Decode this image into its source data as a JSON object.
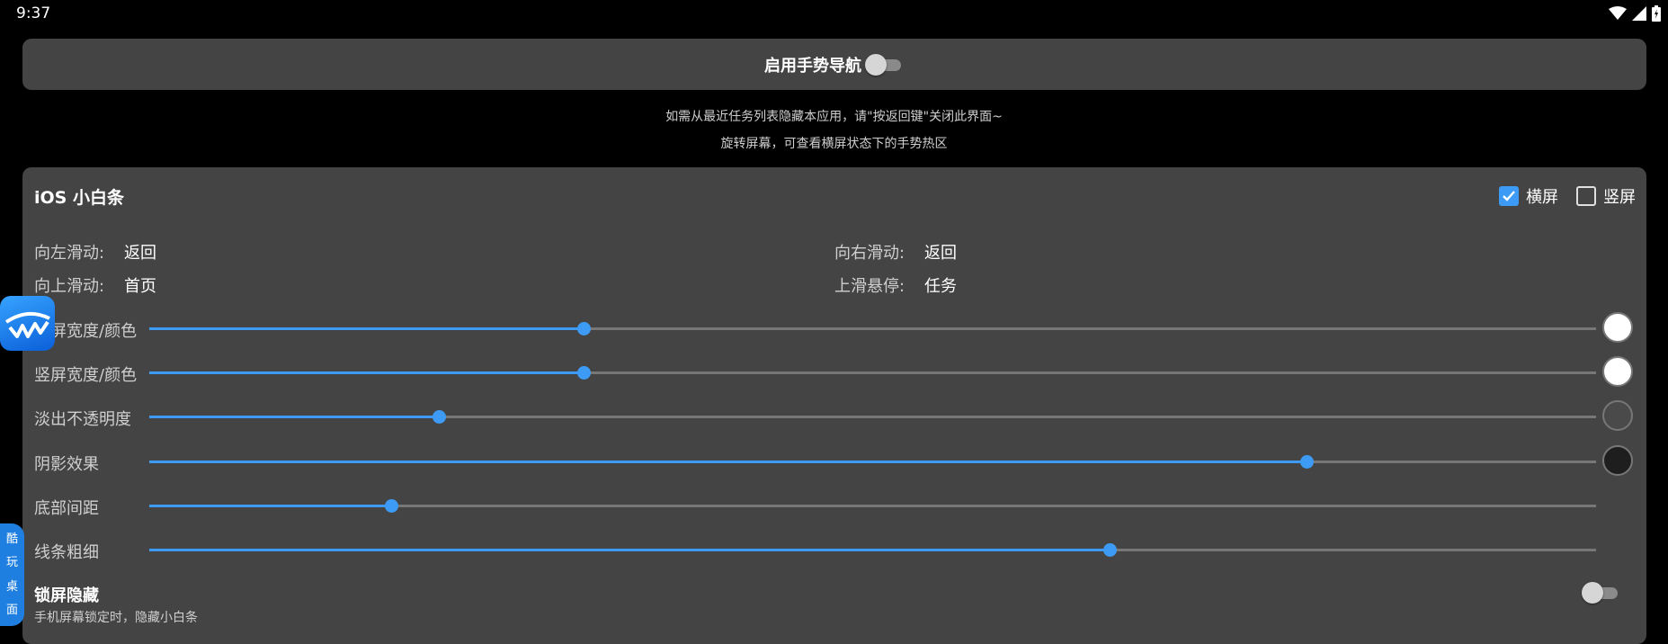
{
  "status_bar": {
    "time": "9:37",
    "icons": [
      "wifi-icon",
      "signal-icon",
      "battery-icon"
    ]
  },
  "gesture_nav": {
    "label": "启用手势导航",
    "enabled": false
  },
  "hints": [
    "如需从最近任务列表隐藏本应用，请\"按返回键\"关闭此界面~",
    "旋转屏幕，可查看横屏状态下的手势热区"
  ],
  "card": {
    "title": "iOS 小白条",
    "orientation": {
      "landscape": {
        "label": "横屏",
        "checked": true
      },
      "portrait": {
        "label": "竖屏",
        "checked": false
      }
    },
    "actions": [
      {
        "key": "向左滑动:",
        "value": "返回"
      },
      {
        "key": "向右滑动:",
        "value": "返回"
      },
      {
        "key": "向上滑动:",
        "value": "首页"
      },
      {
        "key": "上滑悬停:",
        "value": "任务"
      }
    ],
    "sliders": [
      {
        "label": "横屏宽度/颜色",
        "value": 0.3,
        "color": "#ffffff"
      },
      {
        "label": "竖屏宽度/颜色",
        "value": 0.3,
        "color": "#ffffff"
      },
      {
        "label": "淡出不透明度",
        "value": 0.2,
        "color": "#4a4a4a"
      },
      {
        "label": "阴影效果",
        "value": 0.8,
        "color": "#1e1e1e"
      },
      {
        "label": "底部间距",
        "value": 0.167
      },
      {
        "label": "线条粗细",
        "value": 0.664
      }
    ],
    "lock_hide": {
      "title": "锁屏隐藏",
      "description": "手机屏幕锁定时，隐藏小白条",
      "enabled": false
    }
  },
  "side_tab": {
    "chars": [
      "酷",
      "玩",
      "桌",
      "面"
    ]
  },
  "colors": {
    "accent": "#3d9bf5",
    "card_bg": "#444444",
    "page_bg": "#000000"
  }
}
